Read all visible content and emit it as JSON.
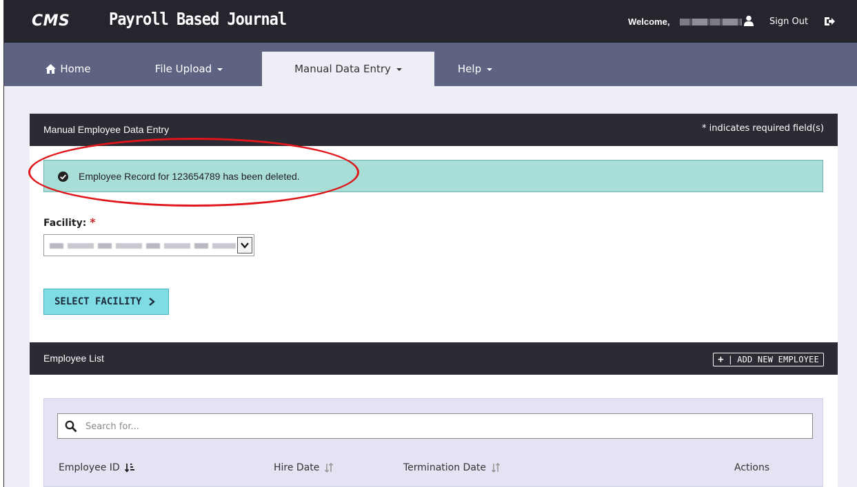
{
  "header": {
    "brand": "CMS",
    "app_title": "Payroll Based Journal",
    "welcome_label": "Welcome,",
    "signout_label": "Sign Out"
  },
  "nav": {
    "items": [
      {
        "label": "Home"
      },
      {
        "label": "File Upload"
      },
      {
        "label": "Manual Data Entry"
      },
      {
        "label": "Help"
      }
    ]
  },
  "entry_panel": {
    "title": "Manual Employee Data Entry",
    "required_note": "* indicates required field(s)",
    "alert_text": "Employee Record for 123654789 has been deleted.",
    "facility_label": "Facility:",
    "facility_required_mark": "*",
    "select_button_label": "SELECT FACILITY"
  },
  "list_panel": {
    "title": "Employee List",
    "add_button_label": "ADD NEW EMPLOYEE",
    "add_button_separator": "|",
    "search_placeholder": "Search for...",
    "columns": [
      {
        "label": "Employee ID"
      },
      {
        "label": "Hire Date"
      },
      {
        "label": "Termination Date"
      },
      {
        "label": "Actions"
      }
    ]
  },
  "colors": {
    "topbar": "#24252d",
    "navbar": "#5d6381",
    "alert_bg": "#a8ddd8",
    "button_bg": "#7fdbe4",
    "annotation": "#e0161b",
    "required_star": "#c8242a"
  }
}
